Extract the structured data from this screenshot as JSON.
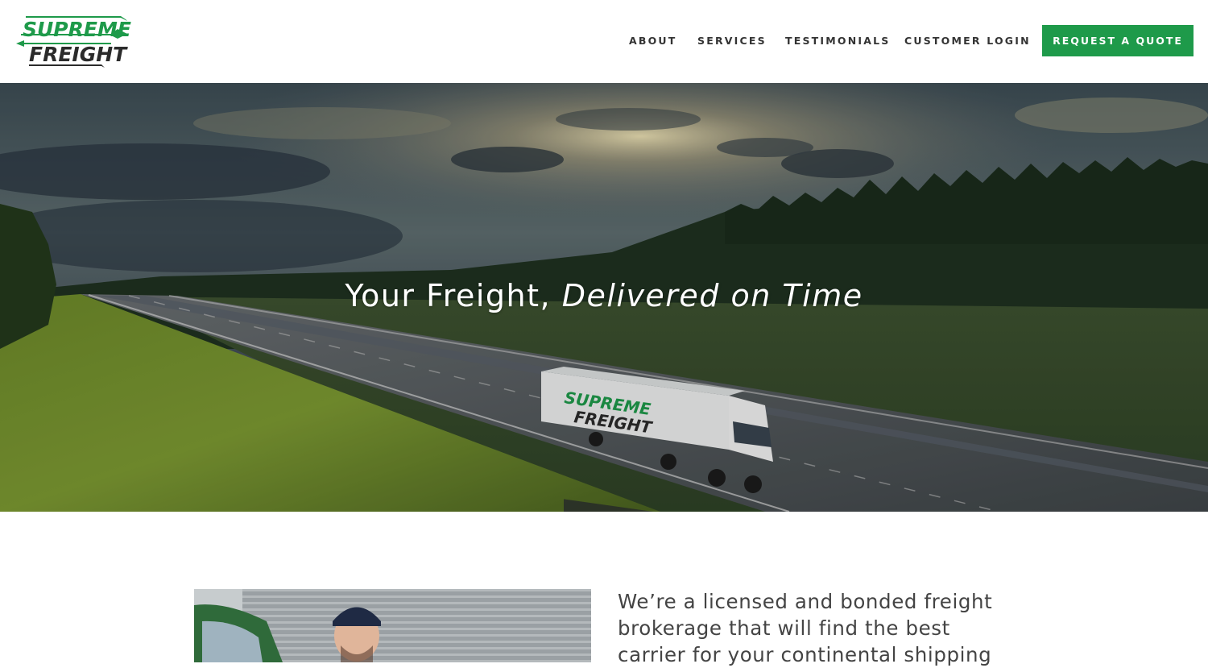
{
  "brand": {
    "logo_top": "SUPREME",
    "logo_bottom": "FREIGHT",
    "accent_color": "#1e9a4a",
    "dark_color": "#2b2b2b"
  },
  "nav": {
    "items": [
      {
        "label": "ABOUT"
      },
      {
        "label": "SERVICES"
      },
      {
        "label": "TESTIMONIALS"
      },
      {
        "label": "CUSTOMER LOGIN"
      }
    ],
    "cta_label": "REQUEST A QUOTE"
  },
  "hero": {
    "title_plain": "Your Freight, ",
    "title_italic": "Delivered on Time",
    "truck_logo_top": "SUPREME",
    "truck_logo_bottom": "FREIGHT"
  },
  "about": {
    "text": "We’re a licensed and bonded freight brokerage that will find the best carrier for your continental shipping"
  }
}
